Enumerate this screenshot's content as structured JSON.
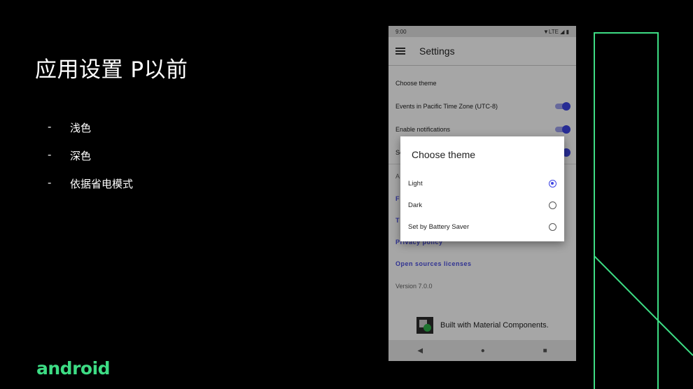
{
  "slide": {
    "title": "应用设置 P以前",
    "bullets": [
      {
        "dash": "-",
        "text": "浅色"
      },
      {
        "dash": "-",
        "text": "深色"
      },
      {
        "dash": "-",
        "text": "依据省电模式"
      }
    ],
    "logo": "android"
  },
  "phone": {
    "status_time": "9:00",
    "status_icons": "▼LTE ◢ ▮",
    "appbar_title": "Settings",
    "settings": {
      "choose_theme": "Choose theme",
      "events_pacific": "Events in Pacific Time Zone (UTC-8)",
      "enable_notifications": "Enable notifications",
      "partial_s": "Se",
      "partial_a": "A",
      "partial_f": "F",
      "partial_t": "T",
      "privacy_policy": "Privacy policy",
      "open_source": "Open sources licenses",
      "version": "Version 7.0.0"
    },
    "built_with": "Built with Material Components.",
    "nav": {
      "back": "◀",
      "home": "●",
      "recents": "■"
    }
  },
  "dialog": {
    "title": "Choose theme",
    "options": [
      {
        "label": "Light",
        "selected": true
      },
      {
        "label": "Dark",
        "selected": false
      },
      {
        "label": "Set by Battery Saver",
        "selected": false
      }
    ]
  },
  "colors": {
    "accent": "#3d44e3",
    "brand": "#3ddc84"
  }
}
